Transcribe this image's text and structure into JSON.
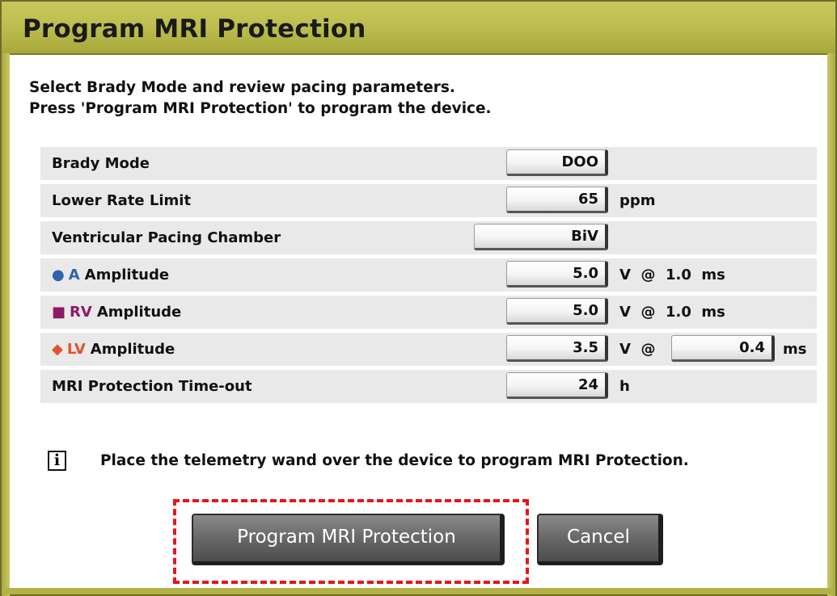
{
  "dialog": {
    "title": "Program MRI Protection",
    "instructions": [
      "Select Brady Mode and review pacing parameters.",
      "Press 'Program MRI Protection' to program the device."
    ]
  },
  "params": {
    "brady_mode": {
      "label": "Brady Mode",
      "value": "DOO"
    },
    "lower_rate_limit": {
      "label": "Lower Rate Limit",
      "value": "65",
      "unit": "ppm"
    },
    "vent_pacing_chamber": {
      "label": "Ventricular Pacing Chamber",
      "value": "BiV"
    },
    "a_amplitude": {
      "marker": "●",
      "channel": "A",
      "label": "Amplitude",
      "value": "5.0",
      "unit": "V  @  1.0  ms",
      "color": "#2f63ad"
    },
    "rv_amplitude": {
      "marker": "■",
      "channel": "RV",
      "label": "Amplitude",
      "value": "5.0",
      "unit": "V  @  1.0  ms",
      "color": "#8c1a68"
    },
    "lv_amplitude": {
      "marker": "◆",
      "channel": "LV",
      "label": "Amplitude",
      "value": "3.5",
      "unit": "V  @",
      "pulse_width": "0.4",
      "pulse_unit": "ms",
      "color": "#e2522d"
    },
    "mri_timeout": {
      "label": "MRI Protection Time-out",
      "value": "24",
      "unit": "h"
    }
  },
  "info": {
    "icon": "i",
    "text": "Place the telemetry wand over the device to program MRI Protection."
  },
  "buttons": {
    "program": "Program MRI Protection",
    "cancel": "Cancel"
  },
  "colors": {
    "title_bar": "#bdbd4f",
    "row_bg": "#e9e9e9",
    "highlight": "#e8141c"
  }
}
